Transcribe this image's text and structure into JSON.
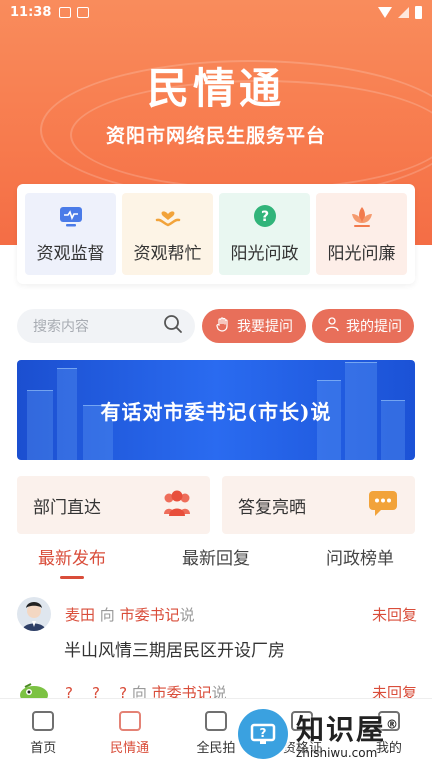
{
  "status_bar": {
    "time": "11:38"
  },
  "header": {
    "title": "民情通",
    "subtitle": "资阳市网络民生服务平台"
  },
  "features": [
    {
      "label": "资观监督",
      "icon": "monitor-icon",
      "color": "#4a7be8"
    },
    {
      "label": "资观帮忙",
      "icon": "helping-hand-icon",
      "color": "#f2a33a"
    },
    {
      "label": "阳光问政",
      "icon": "question-bubble-icon",
      "color": "#31b47a"
    },
    {
      "label": "阳光问廉",
      "icon": "lotus-icon",
      "color": "#f27a4d"
    }
  ],
  "search": {
    "placeholder": "搜索内容"
  },
  "actions": {
    "ask": "我要提问",
    "my_questions": "我的提问"
  },
  "banner": {
    "text": "有话对市委书记(市长)说"
  },
  "boxes": {
    "department": "部门直达",
    "replies": "答复亮晒"
  },
  "tabs": [
    "最新发布",
    "最新回复",
    "问政榜单"
  ],
  "posts": [
    {
      "author": "麦田",
      "verb": "向",
      "target": "市委书记",
      "suffix": "说",
      "status": "未回复",
      "title": "半山风情三期居民区开设厂房"
    },
    {
      "author": "?",
      "mid": "?",
      "mid2": "?",
      "verb": "向",
      "target": "市委书记",
      "suffix": "说",
      "status": "未回复"
    }
  ],
  "bottom_nav": [
    "首页",
    "民情通",
    "全民拍",
    "资格证",
    "我的"
  ],
  "watermark": {
    "cn": "知识屋",
    "en": "zhishiwu.com",
    "mark": "®"
  },
  "colors": {
    "accent": "#d94d3a",
    "header": "#f77a4d",
    "banner": "#2a6bf0"
  }
}
